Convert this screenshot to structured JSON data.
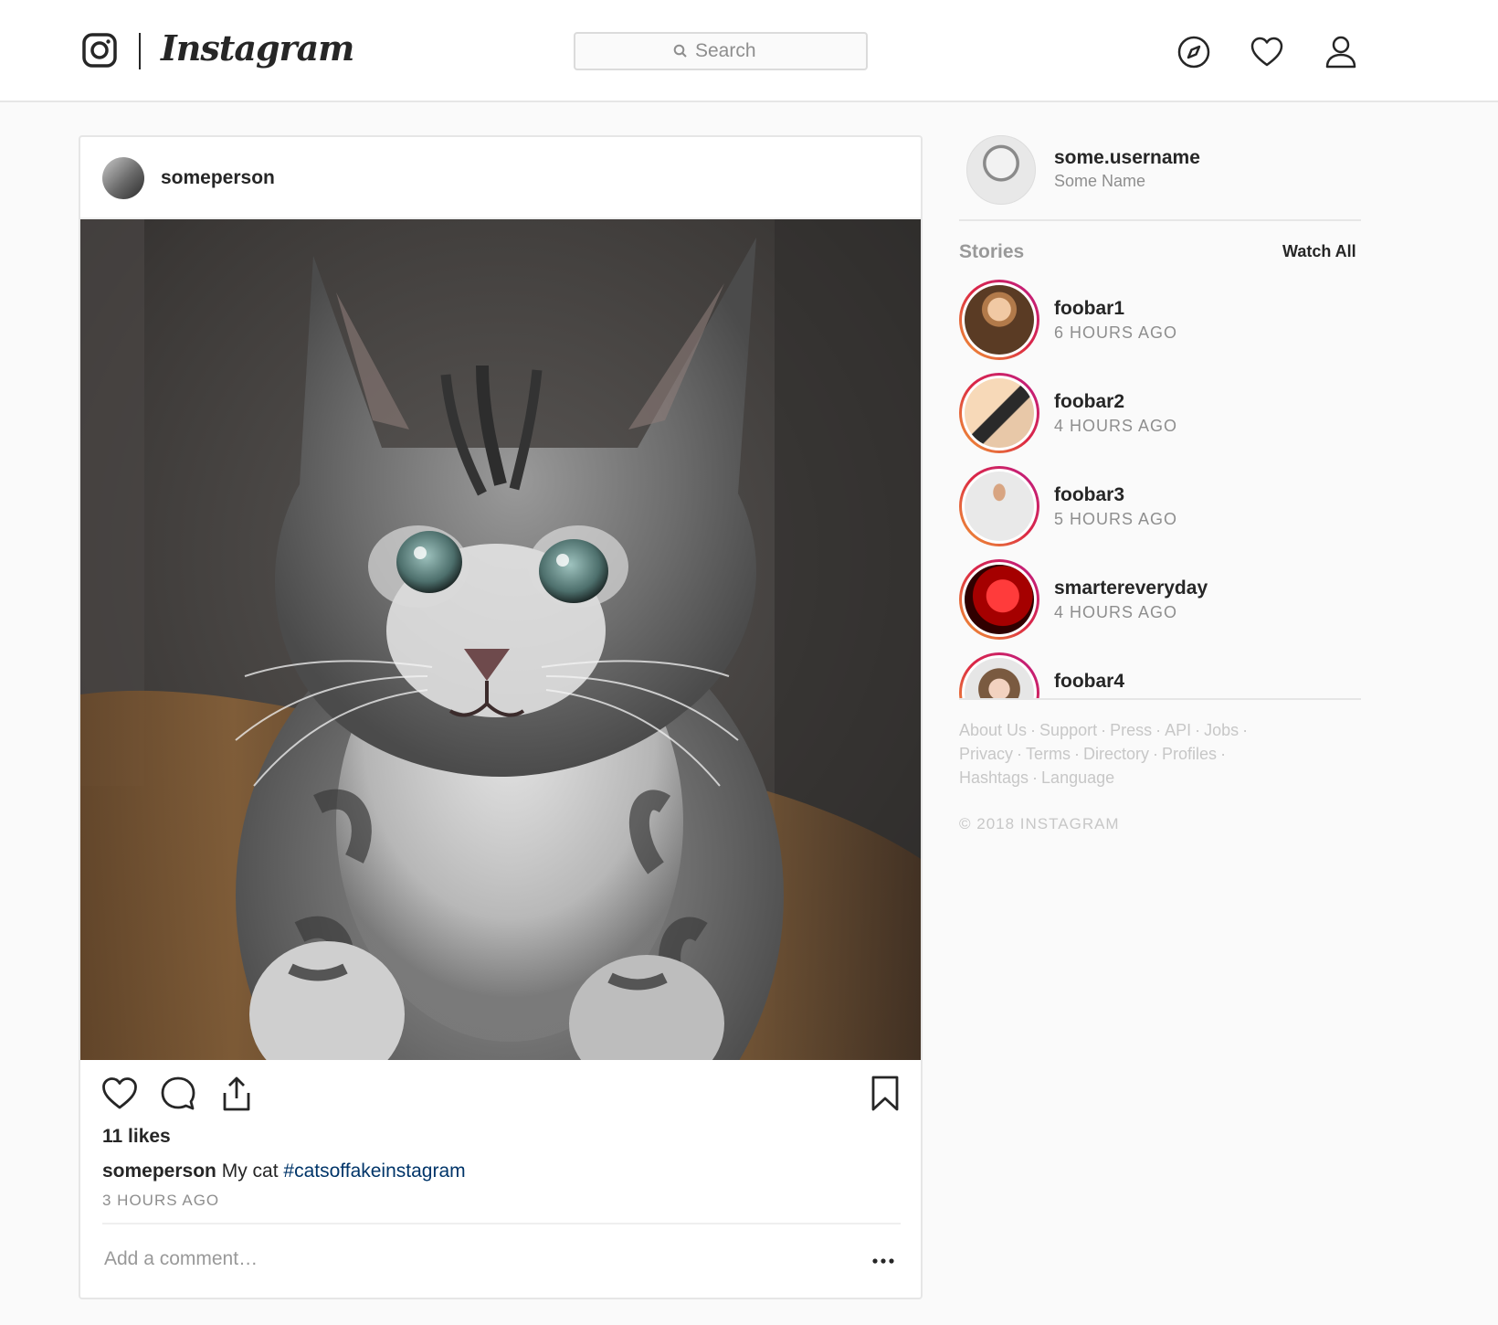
{
  "header": {
    "brand": "Instagram",
    "search_placeholder": "Search",
    "icons": [
      "instagram-glyph-icon",
      "compass-icon",
      "heart-icon",
      "user-icon",
      "search-icon"
    ]
  },
  "post": {
    "username": "someperson",
    "likes": "11 likes",
    "caption_user": "someperson",
    "caption_text": "My cat",
    "caption_hashtag": "#catsoffakeinstagram",
    "time": "3 HOURS AGO",
    "comment_placeholder": "Add a comment…",
    "hashtag_color": "#003569"
  },
  "profile": {
    "username": "some.username",
    "name": "Some Name"
  },
  "stories": {
    "title": "Stories",
    "watch_all": "Watch All",
    "items": [
      {
        "name": "foobar1",
        "time": "6 HOURS AGO"
      },
      {
        "name": "foobar2",
        "time": "4 HOURS AGO"
      },
      {
        "name": "foobar3",
        "time": "5 HOURS AGO"
      },
      {
        "name": "smartereveryday",
        "time": "4 HOURS AGO"
      },
      {
        "name": "foobar4",
        "time": ""
      }
    ],
    "ring_colors": [
      "#f09433",
      "#dc2743",
      "#bc1888"
    ]
  },
  "footer": {
    "links": [
      "About Us",
      "Support",
      "Press",
      "API",
      "Jobs",
      "Privacy",
      "Terms",
      "Directory",
      "Profiles",
      "Hashtags",
      "Language"
    ],
    "copyright": "© 2018 INSTAGRAM"
  }
}
